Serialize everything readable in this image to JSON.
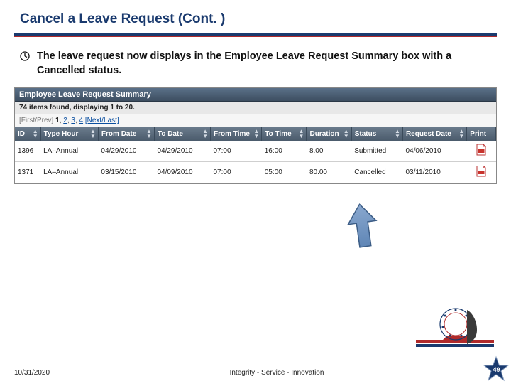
{
  "title": "Cancel a Leave Request (Cont. )",
  "bullet": "The leave request now displays in the Employee Leave Request Summary box with a Cancelled status.",
  "summary": {
    "heading": "Employee Leave Request Summary",
    "found": "74 items found, displaying 1 to 20.",
    "paging": {
      "firstprev": "[First/Prev]",
      "current": "1",
      "p2": "2",
      "p3": "3",
      "p4": "4",
      "nextlast": "[Next/Last]"
    },
    "headers": {
      "id": "ID",
      "type": "Type Hour",
      "from": "From Date",
      "to": "To Date",
      "ftime": "From Time",
      "ttime": "To Time",
      "dur": "Duration",
      "status": "Status",
      "rdate": "Request Date",
      "print": "Print"
    },
    "rows": [
      {
        "id": "1396",
        "type": "LA–Annual",
        "from": "04/29/2010",
        "to": "04/29/2010",
        "ftime": "07:00",
        "ttime": "16:00",
        "dur": "8.00",
        "status": "Submitted",
        "rdate": "04/06/2010"
      },
      {
        "id": "1371",
        "type": "LA–Annual",
        "from": "03/15/2010",
        "to": "04/09/2010",
        "ftime": "07:00",
        "ttime": "05:00",
        "dur": "80.00",
        "status": "Cancelled",
        "rdate": "03/11/2010"
      }
    ]
  },
  "footer": {
    "date": "10/31/2020",
    "motto": "Integrity - Service - Innovation",
    "page": "49"
  }
}
